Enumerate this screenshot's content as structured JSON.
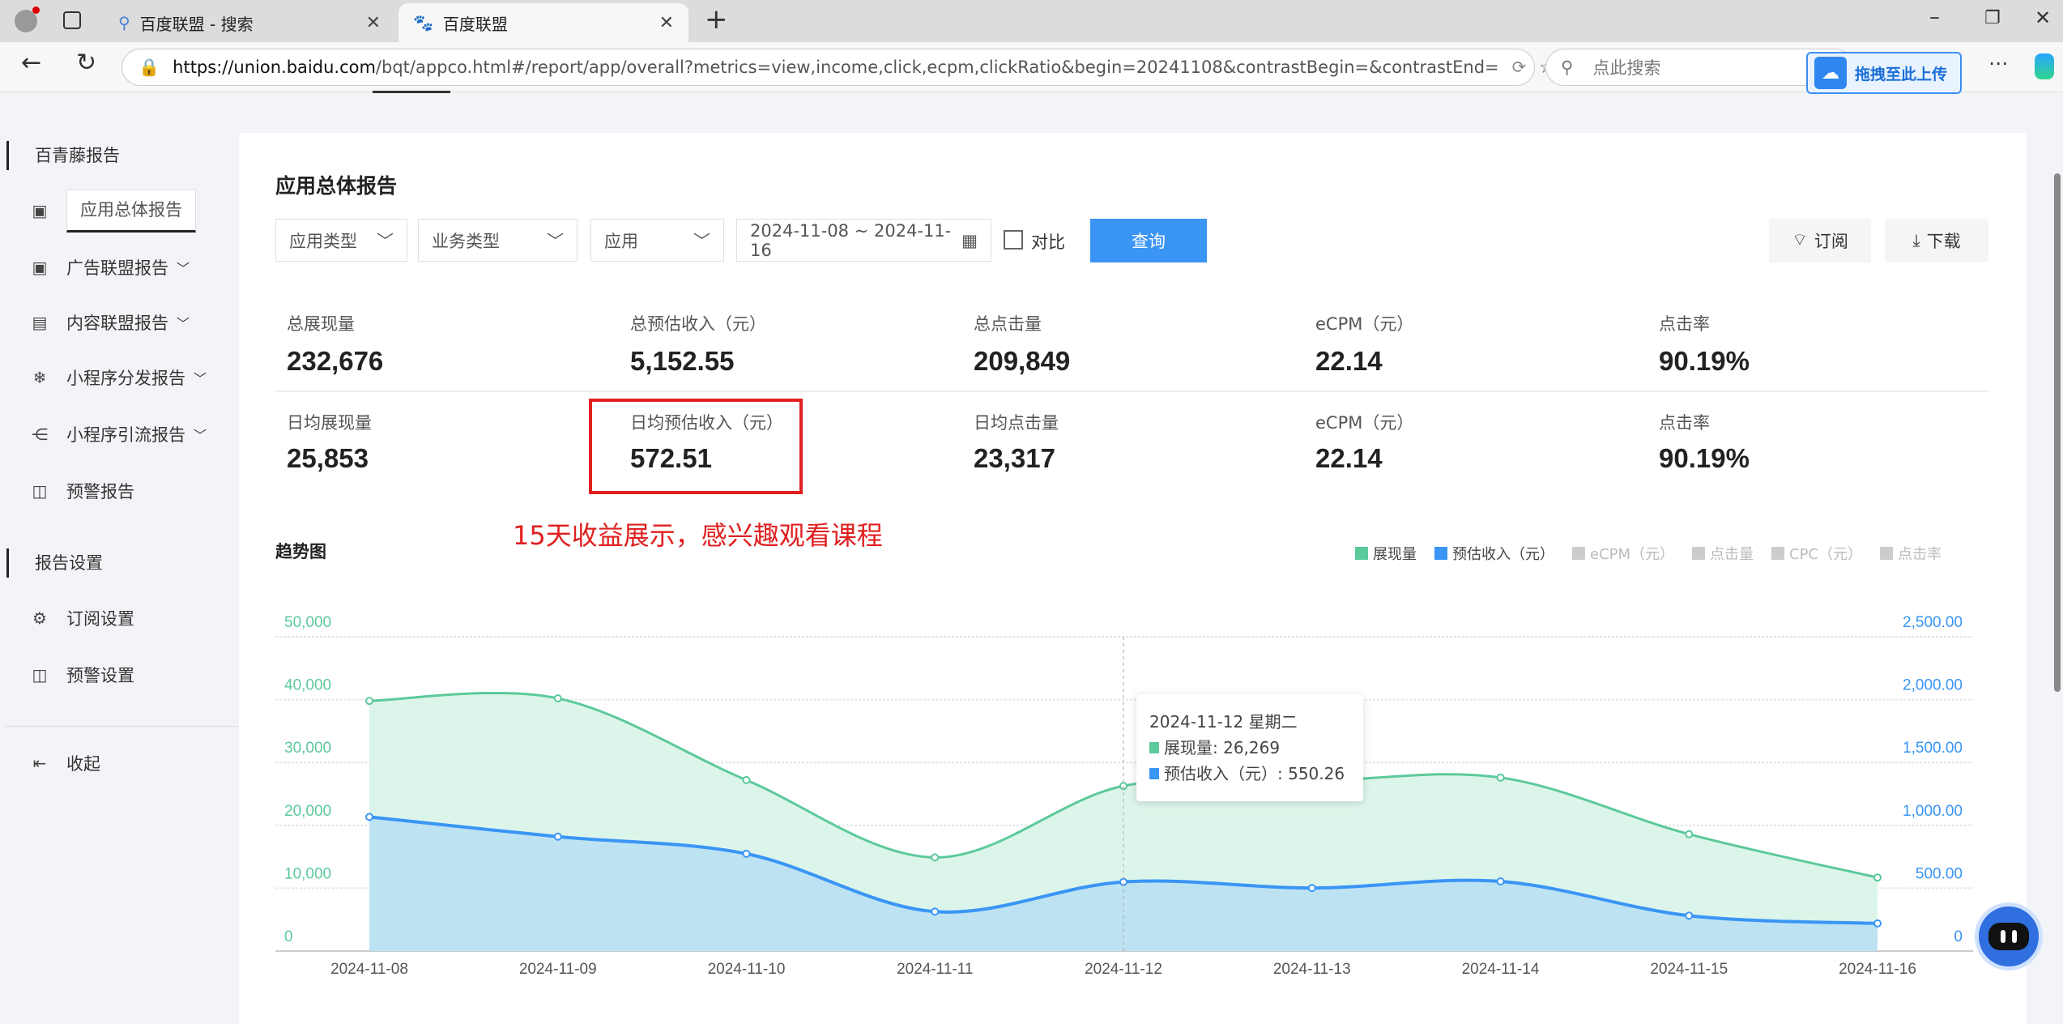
{
  "browser": {
    "tabs": [
      {
        "label": "百度联盟 - 搜索",
        "icon": "search-icon"
      },
      {
        "label": "百度联盟",
        "icon": "baidu-paw-icon"
      }
    ],
    "url_host": "https://union.baidu.com",
    "url_rest": "/bqt/appco.html#/report/app/overall?metrics=view,income,click,ecpm,clickRatio&begin=20241108&contrastBegin=&contrastEnd=",
    "search_placeholder": "点此搜索",
    "upload_label": "拖拽至此上传"
  },
  "sidebar": {
    "groups": [
      {
        "label": "百青藤报告"
      },
      {
        "label": "报告设置"
      }
    ],
    "items": [
      {
        "label": "应用总体报告",
        "icon": "report-icon",
        "selected": true
      },
      {
        "label": "广告联盟报告",
        "icon": "report-icon",
        "expandable": true
      },
      {
        "label": "内容联盟报告",
        "icon": "content-report-icon",
        "expandable": true
      },
      {
        "label": "小程序分发报告",
        "icon": "snowflake-icon",
        "expandable": true
      },
      {
        "label": "小程序引流报告",
        "icon": "share-icon",
        "expandable": true
      },
      {
        "label": "预警报告",
        "icon": "alert-icon"
      },
      {
        "label": "订阅设置",
        "icon": "gear-icon"
      },
      {
        "label": "预警设置",
        "icon": "alert-icon"
      }
    ],
    "collapse_label": "收起"
  },
  "main": {
    "title": "应用总体报告",
    "filters": {
      "app_type": "应用类型",
      "biz_type": "业务类型",
      "app": "应用",
      "date_range": "2024-11-08 ~ 2024-11-16",
      "compare_label": "对比",
      "compare_checked": false,
      "query_label": "查询"
    },
    "subscribe_label": "订阅",
    "download_label": "下载",
    "stats_total": [
      {
        "label": "总展现量",
        "value": "232,676"
      },
      {
        "label": "总预估收入（元）",
        "value": "5,152.55"
      },
      {
        "label": "总点击量",
        "value": "209,849"
      },
      {
        "label": "eCPM（元）",
        "value": "22.14"
      },
      {
        "label": "点击率",
        "value": "90.19%"
      }
    ],
    "stats_daily": [
      {
        "label": "日均展现量",
        "value": "25,853"
      },
      {
        "label": "日均预估收入（元）",
        "value": "572.51"
      },
      {
        "label": "日均点击量",
        "value": "23,317"
      },
      {
        "label": "eCPM（元）",
        "value": "22.14"
      },
      {
        "label": "点击率",
        "value": "90.19%"
      }
    ],
    "annotation": "15天收益展示，感兴趣观看课程",
    "annotation_color": "#e02020",
    "trend_title": "趋势图"
  },
  "chart_data": {
    "type": "area",
    "categories": [
      "2024-11-08",
      "2024-11-09",
      "2024-11-10",
      "2024-11-11",
      "2024-11-12",
      "2024-11-13",
      "2024-11-14",
      "2024-11-15",
      "2024-11-16"
    ],
    "series": [
      {
        "name": "展现量",
        "color": "#5cc99b",
        "axis": "left",
        "active": true,
        "values": [
          39800,
          40200,
          27200,
          14900,
          26269,
          27000,
          27600,
          18600,
          11700
        ]
      },
      {
        "name": "预估收入（元）",
        "color": "#3a95f5",
        "axis": "right",
        "active": true,
        "values": [
          1067,
          910,
          774,
          314,
          550.26,
          502,
          554,
          282,
          220
        ]
      }
    ],
    "legend": [
      {
        "name": "展现量",
        "color": "#5cc99b",
        "active": true
      },
      {
        "name": "预估收入（元）",
        "color": "#3a95f5",
        "active": true
      },
      {
        "name": "eCPM（元）",
        "color": "#cccccc",
        "active": false
      },
      {
        "name": "点击量",
        "color": "#cccccc",
        "active": false
      },
      {
        "name": "CPC（元）",
        "color": "#cccccc",
        "active": false
      },
      {
        "name": "点击率",
        "color": "#cccccc",
        "active": false
      }
    ],
    "legend_position": "top-right",
    "left_axis": {
      "ylim": [
        0,
        50000
      ],
      "ticks": [
        "0",
        "10,000",
        "20,000",
        "30,000",
        "40,000",
        "50,000"
      ],
      "color": "#5cc99b"
    },
    "right_axis": {
      "ylim": [
        0,
        2500
      ],
      "ticks": [
        "0",
        "500.00",
        "1,000.00",
        "1,500.00",
        "2,000.00",
        "2,500.00"
      ],
      "color": "#3a95f5"
    },
    "grid": true,
    "tooltip": {
      "title": "2024-11-12 星期二",
      "line1": "展现量: 26,269",
      "line2": "预估收入（元）: 550.26"
    }
  }
}
